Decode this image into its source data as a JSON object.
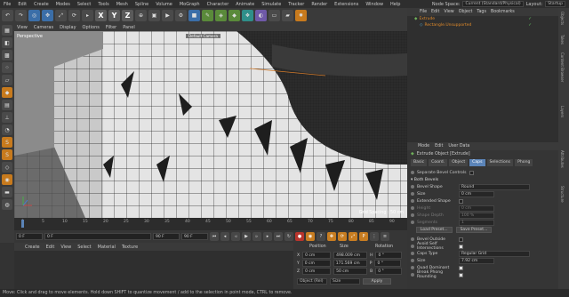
{
  "menubar": {
    "items": [
      "File",
      "Edit",
      "Create",
      "Modes",
      "Select",
      "Tools",
      "Mesh",
      "Spline",
      "Volume",
      "MoGraph",
      "Character",
      "Animate",
      "Simulate",
      "Tracker",
      "Render",
      "Extensions",
      "Window",
      "Help"
    ],
    "node_space_label": "Node Space:",
    "node_space_value": "Current (Standard/Physical)",
    "layout_label": "Layout:",
    "layout_value": "Startup"
  },
  "viewport": {
    "menu": [
      "View",
      "Cameras",
      "Display",
      "Options",
      "Filter",
      "Panel"
    ],
    "label": "Perspective",
    "camera_label": "Default Camera",
    "grid_spacing": "Grid Spacing : 50 cm"
  },
  "timeline": {
    "ticks": [
      "0",
      "5",
      "10",
      "15",
      "20",
      "25",
      "30",
      "35",
      "40",
      "45",
      "50",
      "55",
      "60",
      "65",
      "70",
      "75",
      "80",
      "85",
      "90"
    ],
    "start_frame": "0 F",
    "current_frame": "0 F",
    "end_frame": "90 F",
    "end_frame2": "90 F",
    "frame_readout": "0 F"
  },
  "material_manager": {
    "menu": [
      "Create",
      "Edit",
      "View",
      "Select",
      "Material",
      "Texture"
    ]
  },
  "coordinates": {
    "headers": [
      "Position",
      "Size",
      "Rotation"
    ],
    "rows": [
      {
        "axis": "X",
        "pos": "0 cm",
        "size": "498.009 cm",
        "rot_axis": "H",
        "rot": "0 °"
      },
      {
        "axis": "Y",
        "pos": "0 cm",
        "size": "171.569 cm",
        "rot_axis": "P",
        "rot": "0 °"
      },
      {
        "axis": "Z",
        "pos": "0 cm",
        "size": "50 cm",
        "rot_axis": "B",
        "rot": "0 °"
      }
    ],
    "mode": "Object (Rel)",
    "size_mode": "Size",
    "apply": "Apply"
  },
  "status_bar": {
    "text": "Move: Click and drag to move elements. Hold down SHIFT to quantize movement / add to the selection in point mode, CTRL to remove."
  },
  "object_manager": {
    "menu": [
      "File",
      "Edit",
      "View",
      "Object",
      "Tags",
      "Bookmarks"
    ],
    "objects": [
      {
        "name": "Extrude",
        "color": "#e08a2a"
      },
      {
        "name": "Rectangle.Unsupported",
        "color": "#e08a2a"
      }
    ]
  },
  "right_strip": [
    "Objects",
    "Takes",
    "Content Browser",
    "Layers",
    "Attributes",
    "Structure"
  ],
  "attribute_manager": {
    "menu": [
      "Mode",
      "Edit",
      "User Data"
    ],
    "title": "Extrude Object [Extrude]",
    "tabs": [
      "Basic",
      "Coord.",
      "Object",
      "Caps",
      "Selections",
      "Phong"
    ],
    "active_tab": "Caps",
    "separate_bevel_controls": "Separate Bevel Controls",
    "section_both_bevels": "Both Bevels",
    "bevel_shape_label": "Bevel Shape",
    "bevel_shape_value": "Round",
    "size_label": "Size",
    "size_value": "0 cm",
    "extended_shape_label": "Extended Shape",
    "height_label": "Height",
    "height_value": "0 cm",
    "shape_depth_label": "Shape Depth",
    "shape_depth_value": "100 %",
    "segments_label": "Segments",
    "segments_value": "1",
    "load_preset": "Load Preset...",
    "save_preset": "Save Preset...",
    "bevel_outside": "Bevel Outside",
    "avoid_self_intersections": "Avoid Self Intersections",
    "caps_type_label": "Caps Type",
    "caps_type_value": "Regular Grid",
    "size2_label": "Size",
    "size2_value": "7.92 cm",
    "quad_dominant": "Quad Dominant",
    "break_phong": "Break Phong Rounding"
  }
}
